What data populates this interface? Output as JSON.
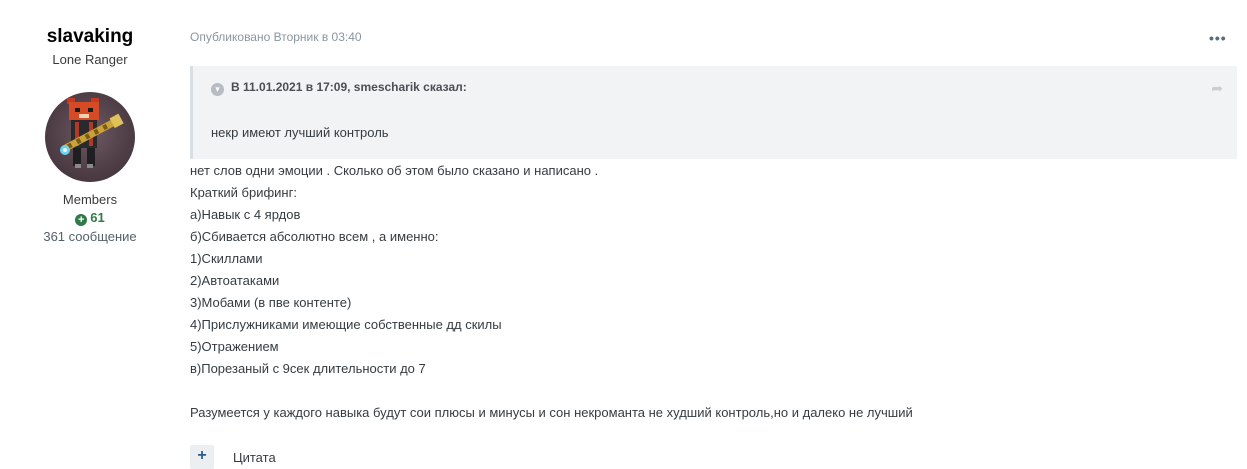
{
  "author": {
    "username": "slavaking",
    "title": "Lone Ranger",
    "group": "Members",
    "reputation": "61",
    "posts": "361 сообщение"
  },
  "post": {
    "published": "Опубликовано Вторник в 03:40",
    "quote": {
      "header": "В 11.01.2021 в 17:09, smescharik сказал:",
      "text": "некр имеют лучший контроль"
    },
    "lines": [
      "нет слов одни эмоции . Сколько об этом было сказано и написано .",
      "Краткий брифинг:",
      "а)Навык с 4 ярдов",
      "б)Сбивается абсолютно всем , а именно:",
      "1)Скиллами",
      "2)Автоатаками",
      "3)Мобами (в пве контенте)",
      "4)Прислужниками имеющие собственные дд скилы",
      "5)Отражением",
      "в)Порезаный с 9сек длительности до 7"
    ],
    "conclusion": "Разумеется у каждого навыка будут сои плюсы и минусы и сон некроманта не худший контроль,но и далеко не лучший",
    "quote_button_label": "Цитата"
  },
  "colors": {
    "reputation": "#2f7a46",
    "quote_background": "#f2f3f4",
    "meta_text": "#8b95a0"
  },
  "icons": {
    "more": "ellipsis-icon",
    "quote_toggle": "chevron-down-icon",
    "share": "share-icon",
    "reputation": "plus-circle-icon",
    "multiquote": "plus-icon"
  }
}
